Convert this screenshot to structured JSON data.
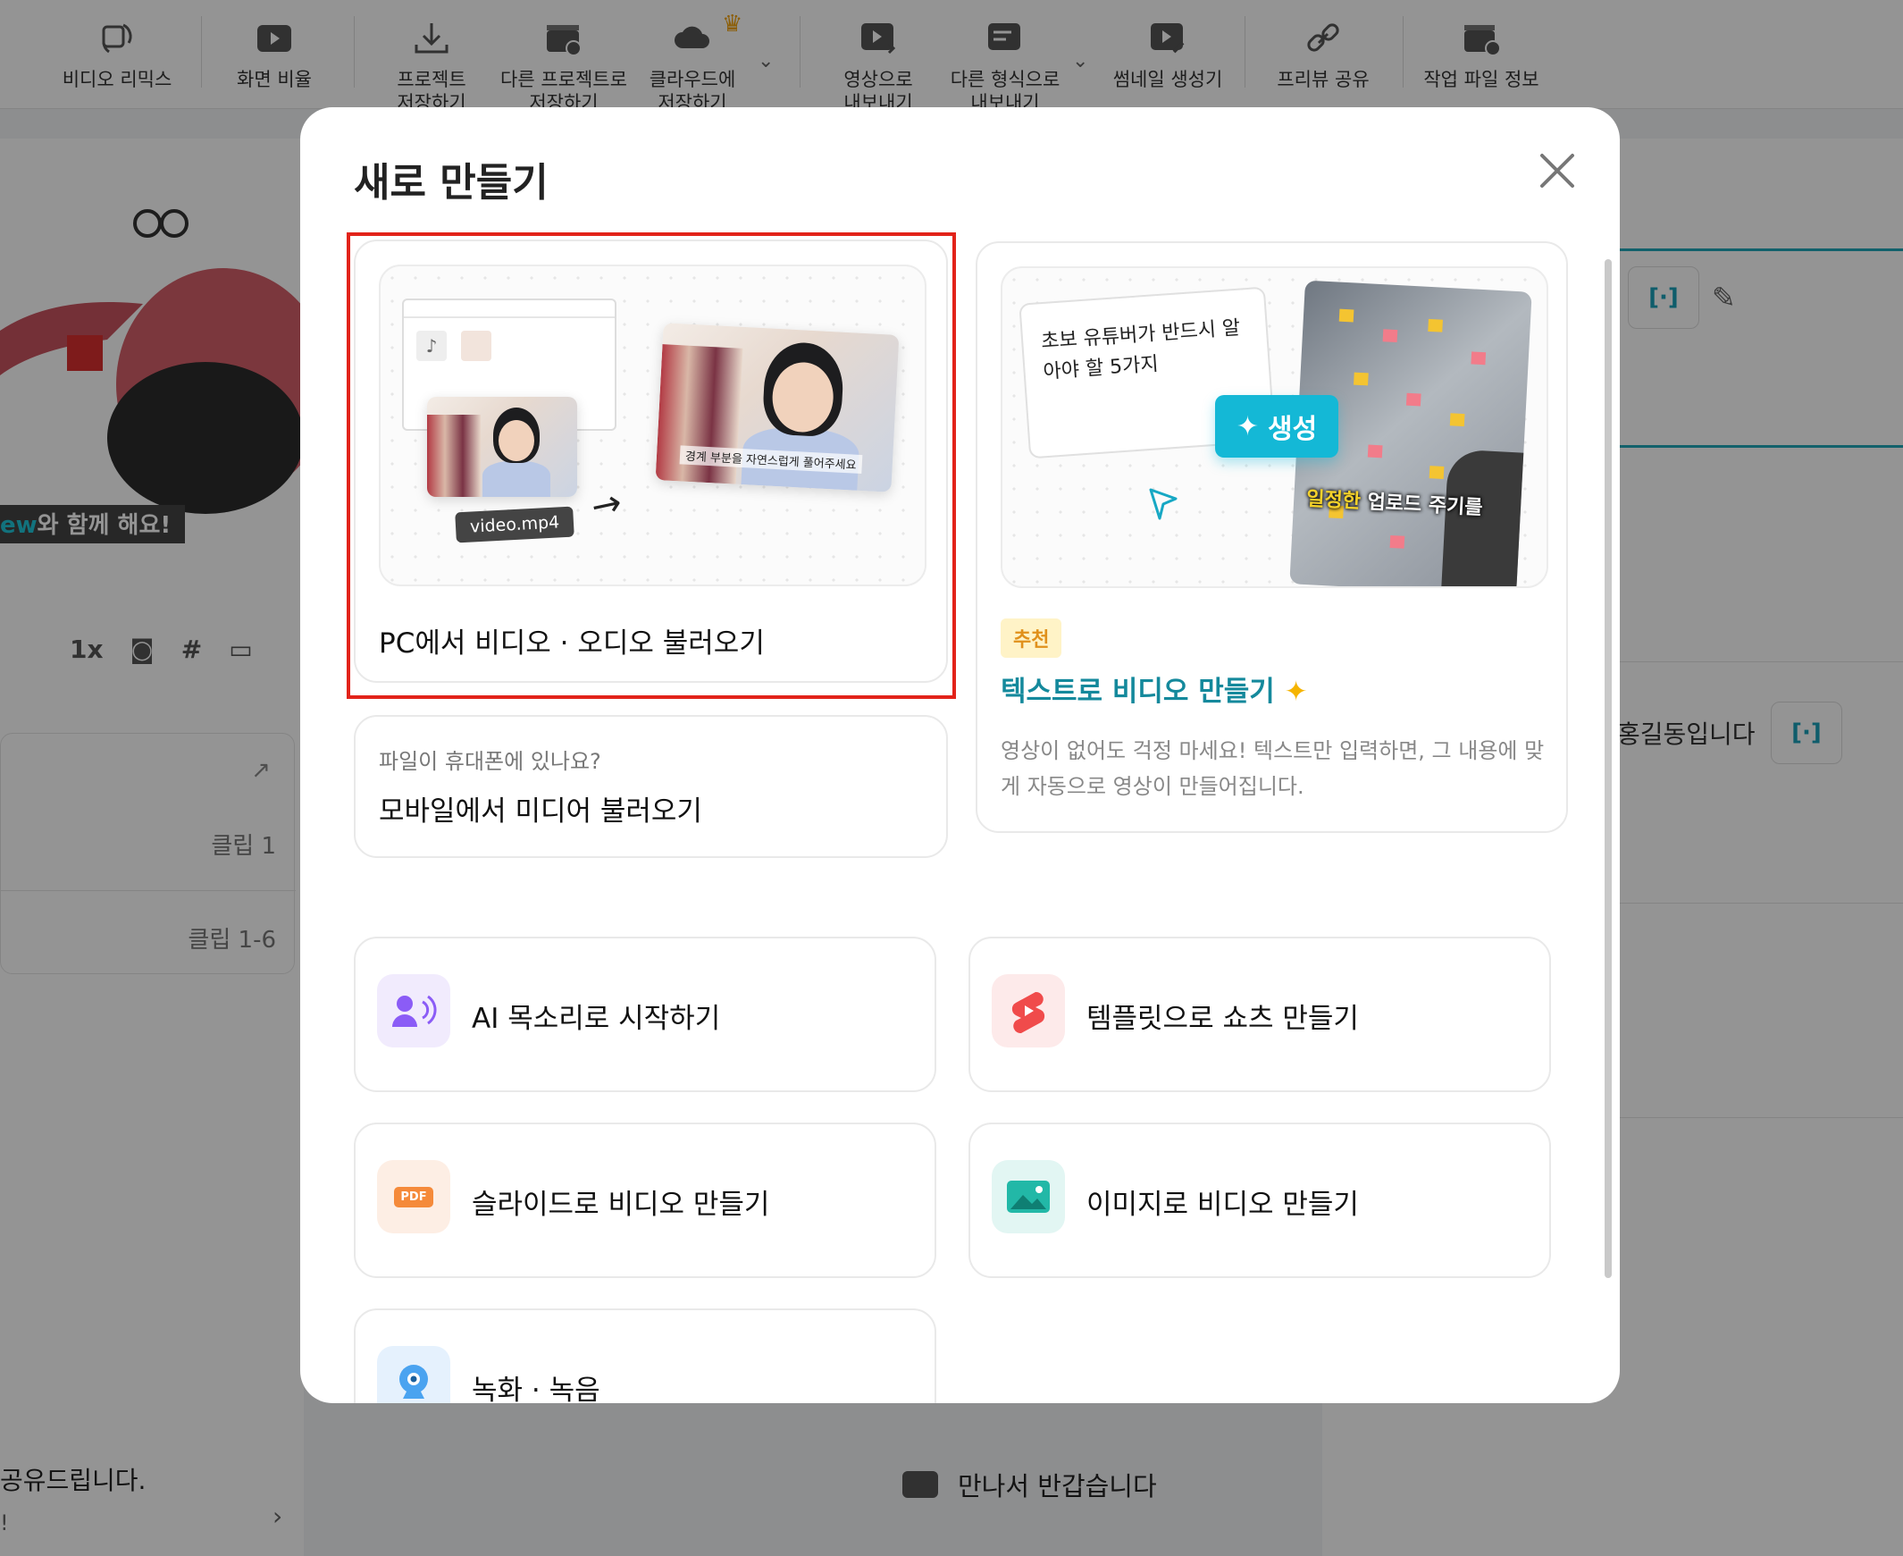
{
  "toolbar": {
    "items": [
      {
        "label": "비디오 리믹스",
        "icon": "remix-icon"
      },
      {
        "label": "화면 비율",
        "icon": "aspect-ratio-icon"
      },
      {
        "label": "프로젝트\n저장하기",
        "icon": "download-icon"
      },
      {
        "label": "다른 프로젝트로\n저장하기",
        "icon": "clapper-save-icon"
      },
      {
        "label": "클라우드에\n저장하기",
        "icon": "cloud-icon"
      },
      {
        "label": "영상으로\n내보내기",
        "icon": "video-export-icon"
      },
      {
        "label": "다른 형식으로\n내보내기",
        "icon": "format-export-icon"
      },
      {
        "label": "썸네일 생성기",
        "icon": "thumbnail-icon"
      },
      {
        "label": "프리뷰 공유",
        "icon": "link-icon"
      },
      {
        "label": "작업 파일 정보",
        "icon": "file-info-icon"
      }
    ]
  },
  "background": {
    "caption_highlight": "ew",
    "caption_rest": "와 함께 해요!",
    "speed": "1x",
    "clip_1": "클립 1",
    "clip_2": "클립 1-6",
    "bottom_left_text": "공유드립니다.",
    "bottom_left_sub": "!",
    "right_text": "홍길동입니다",
    "bottom_center_text": "만나서 반갑습니다",
    "bracket": "[·]"
  },
  "modal": {
    "title": "새로 만들기",
    "pc_import": {
      "label": "PC에서 비디오 · 오디오 불러오기",
      "file_chip": "video.mp4",
      "subtitle_sample": "경계 부분을 자연스럽게 풀어주세요"
    },
    "mobile_import": {
      "hint": "파일이 휴대폰에 있나요?",
      "label": "모바일에서 미디어 불러오기"
    },
    "text_to_video": {
      "prompt_line1": "초보 유튜버가 반드시 알",
      "prompt_line2": "아야 할 5가지",
      "generate_label": "생성",
      "overlay_highlight": "일정한",
      "overlay_rest": " 업로드 주기를",
      "badge": "추천",
      "title": "텍스트로 비디오 만들기",
      "desc_line1": "영상이 없어도 걱정 마세요! 텍스트만 입력하면, 그 내용에 맞",
      "desc_line2": "게 자동으로 영상이 만들어집니다."
    },
    "options": [
      {
        "label": "AI 목소리로 시작하기",
        "icon": "ai-voice-icon",
        "color": "#8b5cf6"
      },
      {
        "label": "템플릿으로 쇼츠 만들기",
        "icon": "shorts-icon",
        "color": "#f04b4b"
      },
      {
        "label": "슬라이드로 비디오 만들기",
        "icon": "pdf-icon",
        "color": "#f58a3a"
      },
      {
        "label": "이미지로 비디오 만들기",
        "icon": "image-icon",
        "color": "#22b8a7"
      },
      {
        "label": "녹화 · 녹음",
        "icon": "webcam-icon",
        "color": "#4aa3f0"
      }
    ]
  },
  "colors": {
    "highlight_border": "#e2231a",
    "teal_accent": "#14899c",
    "generate_button": "#14b8d6"
  }
}
